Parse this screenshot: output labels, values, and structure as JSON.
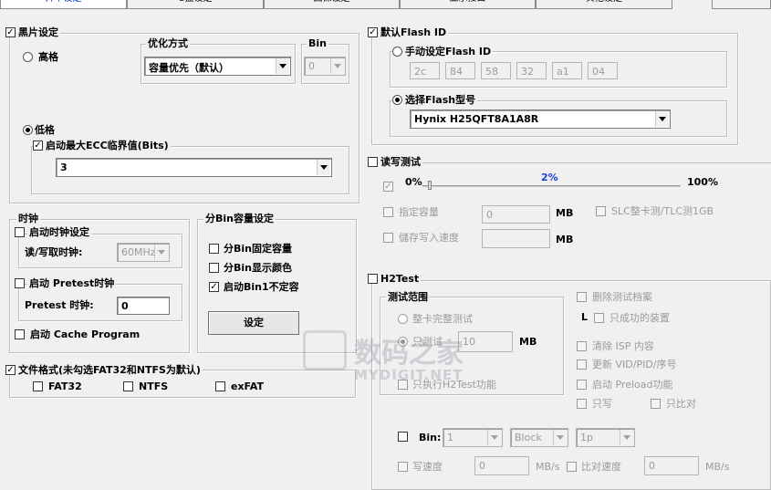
{
  "tabs": {
    "t1": "开卡设定",
    "t2": "U盘设定",
    "t3": "固保设定",
    "t4": "显示接口",
    "t5": "其他设定"
  },
  "chip": {
    "title": "黑片设定",
    "high_grade": "高格",
    "optimize_title": "优化方式",
    "optimize_value": "容量优先（默认）",
    "bin_title": "Bin",
    "bin_value": "0",
    "low_grade": "低格",
    "ecc_label": "启动最大ECC临界值(Bits)",
    "ecc_value": "3"
  },
  "flash_id": {
    "title": "默认Flash ID",
    "manual_label": "手动设定Flash ID",
    "ids": [
      "2c",
      "84",
      "58",
      "32",
      "a1",
      "04"
    ],
    "select_label": "选择Flash型号",
    "model_value": "Hynix H25QFT8A1A8R"
  },
  "clock": {
    "title": "时钟",
    "enable_label": "启动时钟设定",
    "rw_label": "读/写取时钟:",
    "rw_value": "60MHz",
    "pretest_enable": "启动 Pretest时钟",
    "pretest_label": "Pretest 时钟:",
    "pretest_value": "0",
    "cache_label": "启动 Cache Program"
  },
  "bin_capacity": {
    "title": "分Bin容量设定",
    "fixed_label": "分Bin固定容量",
    "color_label": "分Bin显示颜色",
    "bin1_label": "启动Bin1不定容",
    "set_button": "设定"
  },
  "rw_test": {
    "title": "读写测试",
    "pct_min": "0%",
    "pct_now": "2%",
    "pct_max": "100%",
    "progress": 0.02,
    "capacity_label": "指定容量",
    "capacity_value": "0",
    "capacity_unit": "MB",
    "slc_label": "SLC整卡测/TLC测1GB",
    "speed_label": "儲存写入速度",
    "speed_unit": "MB"
  },
  "filesystem": {
    "title": "文件格式(未勾选FAT32和NTFS为默认)",
    "fat32": "FAT32",
    "ntfs": "NTFS",
    "exfat": "exFAT"
  },
  "h2test": {
    "title": "H2Test",
    "range_title": "测试范围",
    "full_test": "整卡完整测试",
    "partial_test": "只测试",
    "partial_value": "10",
    "partial_unit": "MB",
    "only_h2": "只执行H2Test功能",
    "delete_files": "删除测试档案",
    "l_mark": "L",
    "only_ok_device": "只成功的装置",
    "clear_isp": "清除 ISP 内容",
    "update_vid": "更新 VID/PID/序号",
    "preload": "启动 Preload功能",
    "write_only": "只写",
    "compare_only": "只比对",
    "bin_label": "Bin:",
    "bin_value": "1",
    "block_value": "Block",
    "p_value": "1p",
    "write_speed": "写速度",
    "write_speed_value": "0",
    "write_unit": "MB/s",
    "compare_speed": "比对速度",
    "compare_value": "0",
    "compare_unit": "MB/s"
  },
  "watermark": {
    "cn": "数码之家",
    "en": "MYDIGIT.NET"
  }
}
